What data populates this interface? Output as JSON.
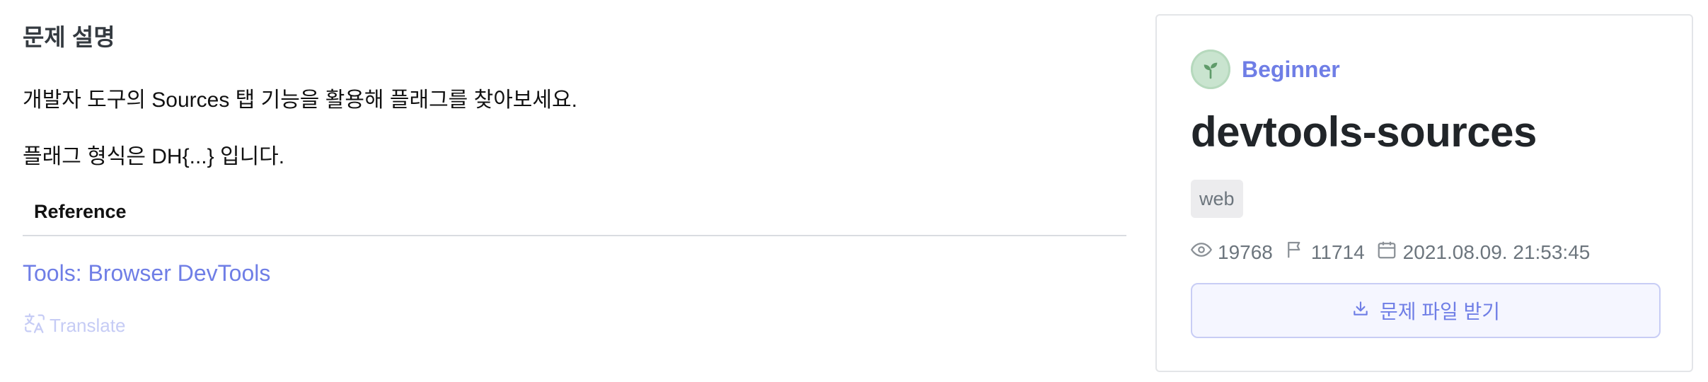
{
  "description": {
    "heading": "문제 설명",
    "line1": "개발자 도구의 Sources 탭 기능을 활용해 플래그를 찾아보세요.",
    "line2": "플래그 형식은 DH{...} 입니다.",
    "reference_header": "Reference",
    "reference_link": "Tools: Browser DevTools",
    "translate_label": "Translate"
  },
  "card": {
    "level": "Beginner",
    "title": "devtools-sources",
    "tag": "web",
    "views": "19768",
    "solves": "11714",
    "date": "2021.08.09. 21:53:45",
    "download_label": "문제 파일 받기"
  },
  "colors": {
    "accent": "#6f7ee6",
    "level_badge": "#c9e4cf",
    "muted": "#6c757d"
  },
  "icons": [
    "sprout-icon",
    "eye-icon",
    "flag-icon",
    "calendar-icon",
    "download-icon",
    "translate-icon"
  ]
}
